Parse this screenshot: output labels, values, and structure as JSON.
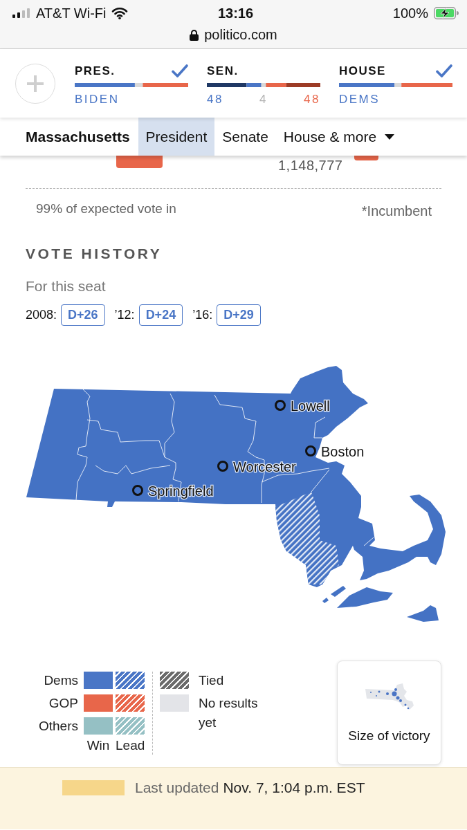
{
  "status_bar": {
    "carrier": "AT&T Wi-Fi",
    "time": "13:16",
    "battery": "100%",
    "url": "politico.com"
  },
  "races": [
    {
      "label": "PRES.",
      "called": true,
      "readings": [
        {
          "text": "BIDEN",
          "color": "#4a76c6"
        }
      ]
    },
    {
      "label": "SEN.",
      "called": false,
      "readings": [
        {
          "text": "48",
          "color": "#4a76c6"
        },
        {
          "text": "4",
          "color": "#b3b3b3"
        },
        {
          "text": "48",
          "color": "#e8664a"
        }
      ]
    },
    {
      "label": "HOUSE",
      "called": true,
      "readings": [
        {
          "text": "DEMS",
          "color": "#4a76c6"
        }
      ]
    }
  ],
  "nav": {
    "state": "Massachusetts",
    "tabs": [
      {
        "label": "President",
        "selected": true,
        "kind": "link"
      },
      {
        "label": "Senate",
        "selected": false,
        "kind": "link"
      },
      {
        "label": "House & more",
        "selected": false,
        "kind": "dropdown"
      }
    ]
  },
  "results": {
    "votes": "1,148,777",
    "reporting": "99% of expected vote in",
    "note": "*Incumbent"
  },
  "vote_history": {
    "title": "VOTE HISTORY",
    "subtitle": "For this seat",
    "entries": [
      {
        "year": "2008:",
        "margin": "D+26"
      },
      {
        "year": "’12:",
        "margin": "D+24"
      },
      {
        "year": "’16:",
        "margin": "D+29"
      }
    ]
  },
  "map": {
    "regions": [
      {
        "leading": false
      },
      {
        "leading": true
      }
    ],
    "cities": [
      {
        "name": "Lowell"
      },
      {
        "name": "Boston"
      },
      {
        "name": "Worcester"
      },
      {
        "name": "Springfield"
      }
    ]
  },
  "legend": {
    "parties": [
      {
        "label": "Dems",
        "color": "#4a76c6"
      },
      {
        "label": "GOP",
        "color": "#e8664a"
      },
      {
        "label": "Others",
        "color": "#95c0c4"
      }
    ],
    "columns": [
      {
        "label": "Win",
        "kind": "win"
      },
      {
        "label": "Lead",
        "kind": "lead"
      }
    ],
    "others": [
      {
        "label": "Tied",
        "kind": "tied"
      },
      {
        "label": "No results yet",
        "kind": "pending"
      }
    ]
  },
  "size_button": {
    "label": "Size of victory"
  },
  "footer": {
    "label": "Last updated",
    "time": "Nov. 7, 1:04 p.m. EST"
  }
}
